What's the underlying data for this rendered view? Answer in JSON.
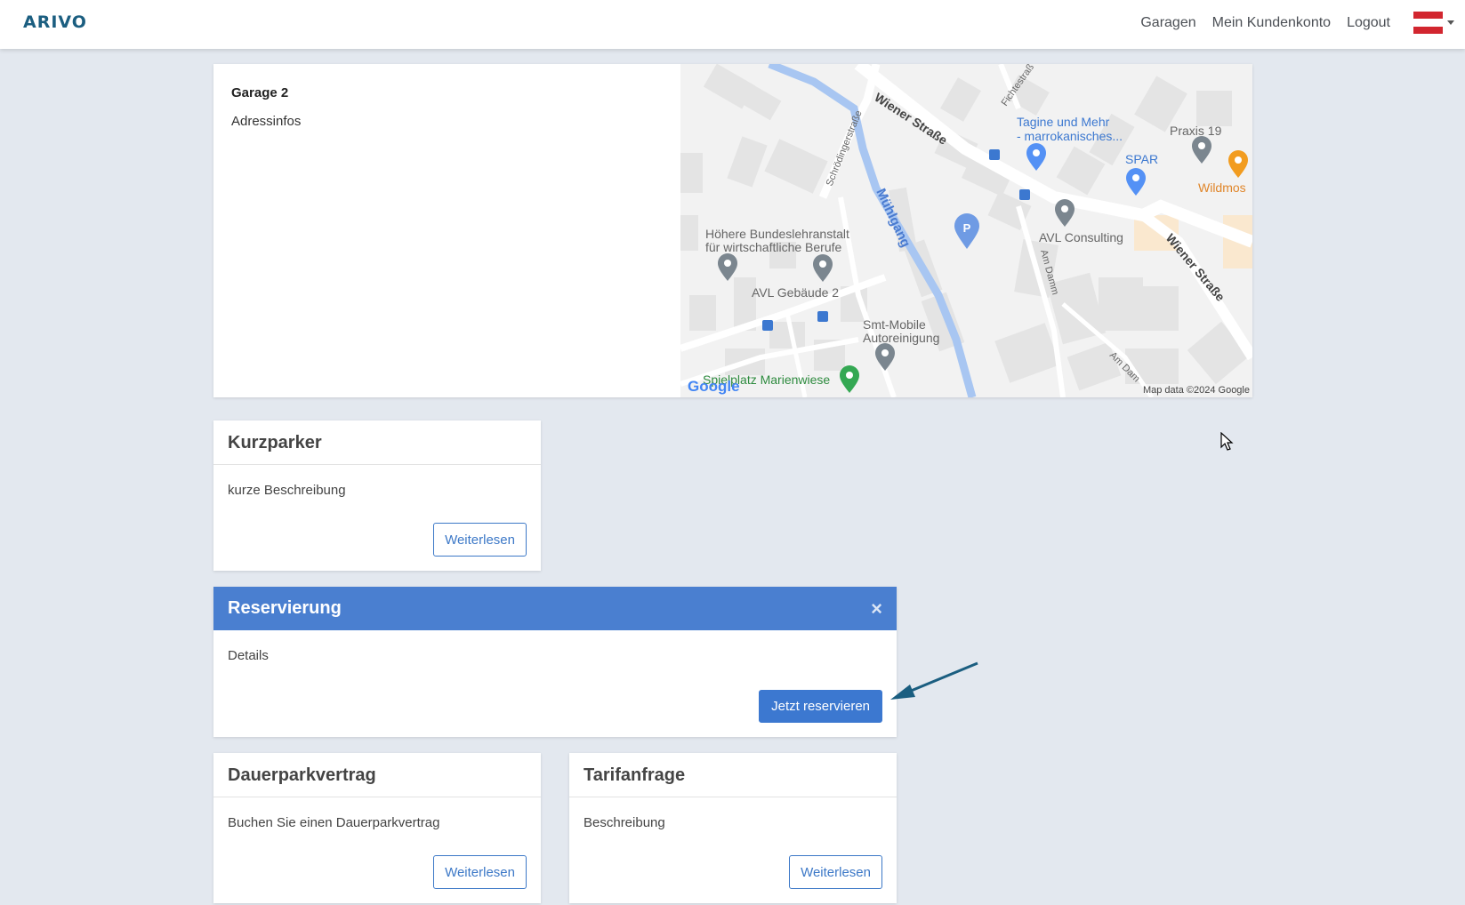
{
  "navbar": {
    "logo": "ARIVO",
    "links": [
      "Garagen",
      "Mein Kundenkonto",
      "Logout"
    ]
  },
  "garage": {
    "title": "Garage 2",
    "address": "Adressinfos"
  },
  "map": {
    "labels": {
      "street_wiener_1": "Wiener Straße",
      "street_wiener_2": "Wiener Straße",
      "street_schroedinger": "Schrödingerstraße",
      "street_fichte": "Fichtestraß",
      "river": "Mühlgang",
      "tagine_1": "Tagine und Mehr",
      "tagine_2": "- marrokanisches...",
      "praxis": "Praxis 19",
      "spar": "SPAR",
      "wildmos": "Wildmos",
      "avl_consulting": "AVL Consulting",
      "hbla_1": "Höhere Bundeslehranstalt",
      "hbla_2": "für wirtschaftliche Berufe",
      "avl_gebaeude": "AVL Gebäude 2",
      "am_damm": "Am Damm",
      "am_damm_2": "Am Dam",
      "smt_1": "Smt-Mobile",
      "smt_2": "Autoreinigung",
      "spielplatz": "Spielplatz Marienwiese",
      "attribution": "Map data ©2024 Google",
      "google": "Google",
      "parking": "P"
    }
  },
  "cards": {
    "kurzparker": {
      "title": "Kurzparker",
      "description": "kurze Beschreibung",
      "button": "Weiterlesen"
    },
    "reservierung": {
      "title": "Reservierung",
      "close": "×",
      "details": "Details",
      "button": "Jetzt reservieren"
    },
    "dauerpark": {
      "title": "Dauerparkvertrag",
      "description": "Buchen Sie einen Dauerparkvertrag",
      "button": "Weiterlesen"
    },
    "tarif": {
      "title": "Tarifanfrage",
      "description": "Beschreibung",
      "button": "Weiterlesen"
    }
  },
  "colors": {
    "brand": "#1b5e80",
    "primary": "#4a7fd0",
    "background": "#e3e8ef",
    "flag_red": "#d2262f",
    "annotation_arrow": "#1b5e80"
  }
}
